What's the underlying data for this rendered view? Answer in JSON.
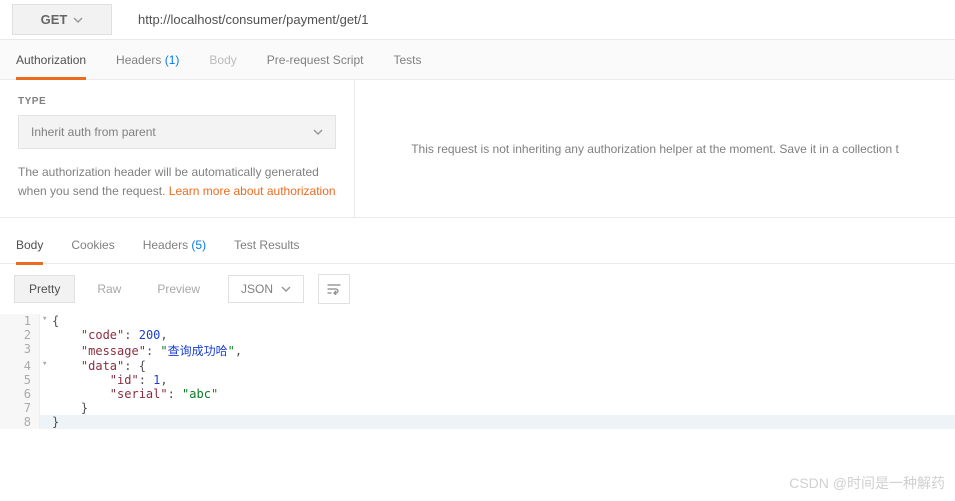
{
  "request": {
    "method": "GET",
    "url": "http://localhost/consumer/payment/get/1"
  },
  "reqTabs": {
    "authorization": "Authorization",
    "headers": "Headers",
    "headers_count": "(1)",
    "body": "Body",
    "prerequest": "Pre-request Script",
    "tests": "Tests"
  },
  "auth": {
    "type_label": "TYPE",
    "selected": "Inherit auth from parent",
    "desc_prefix": "The authorization header will be automatically generated when you send the request. ",
    "learn_more": "Learn more about authorization",
    "right_msg": "This request is not inheriting any authorization helper at the moment. Save it in a collection t"
  },
  "respTabs": {
    "body": "Body",
    "cookies": "Cookies",
    "headers": "Headers",
    "headers_count": "(5)",
    "testresults": "Test Results"
  },
  "viewTabs": {
    "pretty": "Pretty",
    "raw": "Raw",
    "preview": "Preview",
    "format": "JSON"
  },
  "response": {
    "code": 200,
    "message": "查询成功哈",
    "data": {
      "id": 1,
      "serial": "abc"
    }
  },
  "watermark": "CSDN @时间是一种解药"
}
